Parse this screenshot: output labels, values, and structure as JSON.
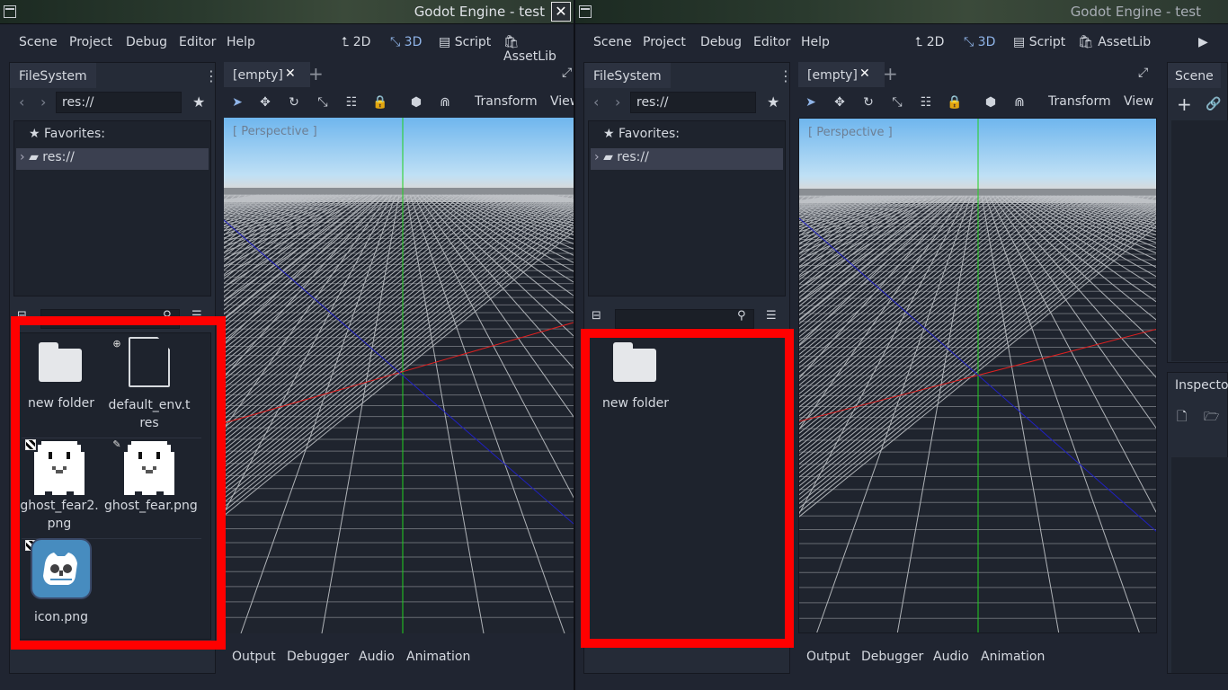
{
  "left_window": {
    "title": "Godot Engine - test",
    "close_label": "✕",
    "menu": [
      "Scene",
      "Project",
      "Debug",
      "Editor",
      "Help"
    ],
    "modes": {
      "m2d": "2D",
      "m3d": "3D",
      "script": "Script",
      "assetlib": "AssetLib"
    },
    "filesystem": {
      "tab": "FileSystem",
      "path": "res://",
      "favorites": "Favorites:",
      "root": "res://",
      "files": [
        {
          "name": "new folder",
          "type": "folder"
        },
        {
          "name": "default_env.tres",
          "type": "resource"
        },
        {
          "name": "ghost_fear2.png",
          "type": "image"
        },
        {
          "name": "ghost_fear.png",
          "type": "image"
        },
        {
          "name": "icon.png",
          "type": "image"
        }
      ]
    },
    "viewport": {
      "tab": "[empty]",
      "tab_close": "✕",
      "add_tab": "+",
      "transform": "Transform",
      "view": "View",
      "perspective": "[ Perspective ]"
    },
    "bottom_tabs": [
      "Output",
      "Debugger",
      "Audio",
      "Animation"
    ]
  },
  "right_window": {
    "title": "Godot Engine - test",
    "menu": [
      "Scene",
      "Project",
      "Debug",
      "Editor",
      "Help"
    ],
    "modes": {
      "m2d": "2D",
      "m3d": "3D",
      "script": "Script",
      "assetlib": "AssetLib"
    },
    "filesystem": {
      "tab": "FileSystem",
      "path": "res://",
      "favorites": "Favorites:",
      "root": "res://",
      "files": [
        {
          "name": "new folder",
          "type": "folder"
        }
      ]
    },
    "viewport": {
      "tab": "[empty]",
      "tab_close": "✕",
      "add_tab": "+",
      "transform": "Transform",
      "view": "View",
      "perspective": "[ Perspective ]"
    },
    "scene_panel": {
      "tab": "Scene",
      "inspector": "Inspecto"
    },
    "bottom_tabs": [
      "Output",
      "Debugger",
      "Audio",
      "Animation"
    ]
  },
  "colors": {
    "highlight": "#ff0000",
    "accent": "#8fb4e8",
    "sky": "#87c3ee",
    "x_axis": "#e02020",
    "y_axis": "#20d020",
    "z_axis": "#2020c0"
  }
}
